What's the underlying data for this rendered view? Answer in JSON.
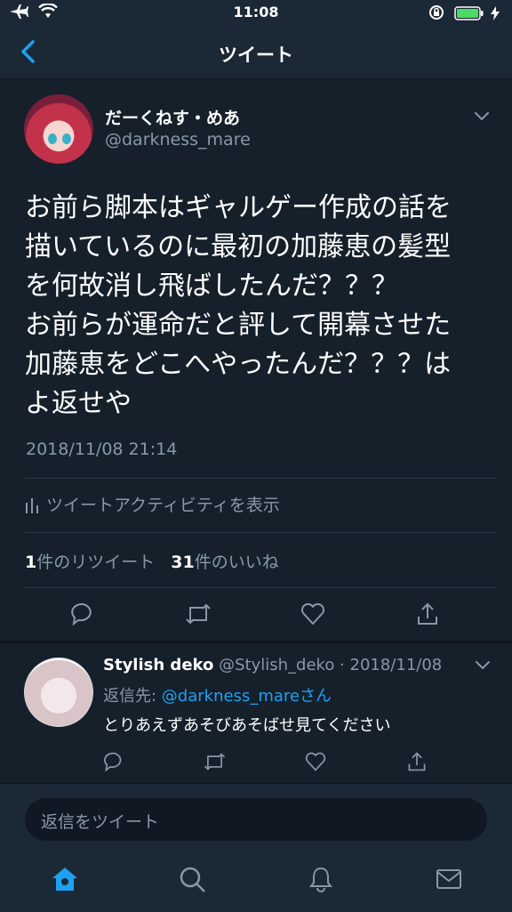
{
  "status_bar": {
    "time": "11:08",
    "icons": [
      "airplane-icon",
      "wifi-icon",
      "rotation-lock-icon",
      "battery-icon",
      "charging-icon"
    ]
  },
  "nav": {
    "title": "ツイート",
    "back_icon": "chevron-left-icon"
  },
  "tweet": {
    "display_name": "だーくねす・めあ",
    "handle": "@darkness_mare",
    "text": "お前ら脚本はギャルゲー作成の話を\n描いているのに最初の加藤恵の髪型\nを何故消し飛ばしたんだ？？？\nお前らが運命だと評して開幕させた\n加藤恵をどこへやったんだ？？？は\nよ返せや",
    "timestamp": "2018/11/08 21:14",
    "activity_label": "ツイートアクティビティを表示",
    "retweet_count": "1",
    "retweet_label": "件のリツイート",
    "like_count": "31",
    "like_label": "件のいいね"
  },
  "reply": {
    "display_name": "Stylish deko",
    "meta": " @Stylish_deko · 2018/11/08",
    "reply_to_prefix": "返信先: ",
    "reply_to_mention": "@darkness_mareさん",
    "text": "とりあえずあそびあそばせ見てください"
  },
  "compose": {
    "placeholder": "返信をツイート"
  },
  "tabs": [
    "home-icon",
    "search-icon",
    "notifications-icon",
    "messages-icon"
  ],
  "colors": {
    "background": "#15202b",
    "bar": "#1b2836",
    "accent": "#1da1f2",
    "secondary_text": "#8899a6"
  }
}
